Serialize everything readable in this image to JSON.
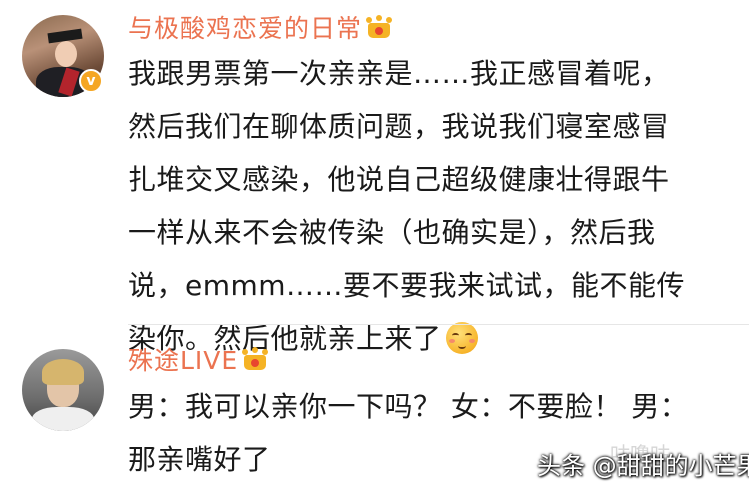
{
  "comments": [
    {
      "username": "与极酸鸡恋爱的日常",
      "avatar_icon": "graduate-avatar",
      "verified_icon": "verified-v-badge",
      "badge_icon": "crown-icon",
      "lines": [
        "我跟男票第一次亲亲是……我正感冒着呢，",
        "然后我们在聊体质问题，我说我们寝室感冒",
        "扎堆交叉感染，他说自己超级健康壮得跟牛",
        "一样从来不会被传染（也确实是），然后我",
        "说，emmm……要不要我来试试，能不能传",
        "染你。然后他就亲上来了"
      ],
      "trailing_emoji": "shy-smile-emoji"
    },
    {
      "username": "殊途LIVE",
      "avatar_icon": "blond-man-avatar",
      "badge_icon": "crown-icon",
      "lines": [
        "男：我可以亲你一下吗？ 女：不要脸！ 男：",
        "那亲嘴好了"
      ]
    }
  ],
  "watermark": {
    "text": "头条 @甜甜的小芒果",
    "faint_text": "咕噜咕"
  },
  "colors": {
    "username": "#eb7350",
    "text": "#1a1a1a",
    "crown": "#f5b325",
    "verified": "#f5a623"
  }
}
